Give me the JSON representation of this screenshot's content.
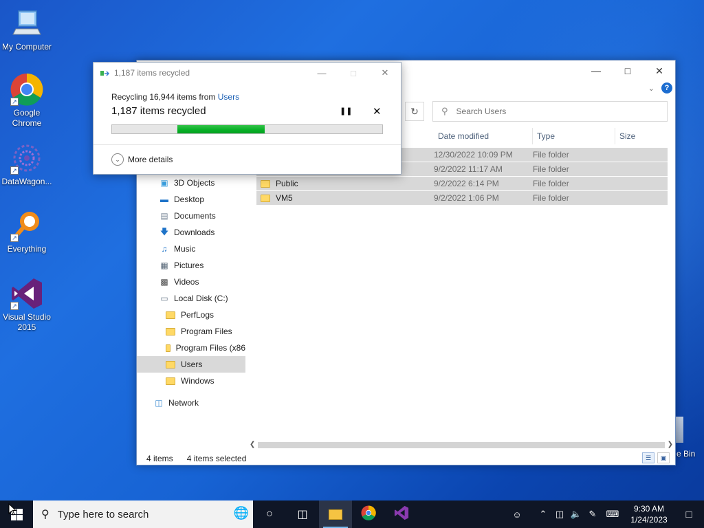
{
  "desktop": {
    "icons": [
      {
        "label": "My Computer"
      },
      {
        "label": "Google Chrome"
      },
      {
        "label": "DataWagon..."
      },
      {
        "label": "Everything"
      },
      {
        "label": "Visual Studio 2015"
      }
    ],
    "recycle_bin_label": "e Bin"
  },
  "explorer": {
    "search_placeholder": "Search Users",
    "columns": {
      "date": "Date modified",
      "type": "Type",
      "size": "Size"
    },
    "files": [
      {
        "name": "",
        "date": "12/30/2022 10:09 PM",
        "type": "File folder"
      },
      {
        "name": "",
        "date": "9/2/2022 11:17 AM",
        "type": "File folder"
      },
      {
        "name": "Public",
        "date": "9/2/2022 6:14 PM",
        "type": "File folder"
      },
      {
        "name": "VM5",
        "date": "9/2/2022 1:06 PM",
        "type": "File folder"
      }
    ],
    "nav": [
      {
        "label": "3D Objects",
        "icon": "3d-objects-icon"
      },
      {
        "label": "Desktop",
        "icon": "desktop-icon"
      },
      {
        "label": "Documents",
        "icon": "documents-icon"
      },
      {
        "label": "Downloads",
        "icon": "downloads-icon"
      },
      {
        "label": "Music",
        "icon": "music-icon"
      },
      {
        "label": "Pictures",
        "icon": "pictures-icon"
      },
      {
        "label": "Videos",
        "icon": "videos-icon"
      },
      {
        "label": "Local Disk (C:)",
        "icon": "drive-icon"
      },
      {
        "label": "PerfLogs",
        "icon": "folder-icon"
      },
      {
        "label": "Program Files",
        "icon": "folder-icon"
      },
      {
        "label": "Program Files (x86",
        "icon": "folder-icon"
      },
      {
        "label": "Users",
        "icon": "folder-icon"
      },
      {
        "label": "Windows",
        "icon": "folder-icon"
      },
      {
        "label": "Network",
        "icon": "network-icon"
      }
    ],
    "status": {
      "count": "4 items",
      "selected": "4 items selected"
    }
  },
  "dialog": {
    "title": "1,187 items recycled",
    "line1_prefix": "Recycling 16,944 items from ",
    "line1_link": "Users",
    "headline": "1,187 items recycled",
    "progress_start": 0.243,
    "progress_end": 0.565,
    "more_details": "More details"
  },
  "taskbar": {
    "search_placeholder": "Type here to search",
    "time": "9:30 AM",
    "date": "1/24/2023"
  },
  "colors": {
    "progress_green": "#06b025",
    "accent": "#1a5fb4",
    "taskbar": "#0f1626"
  }
}
